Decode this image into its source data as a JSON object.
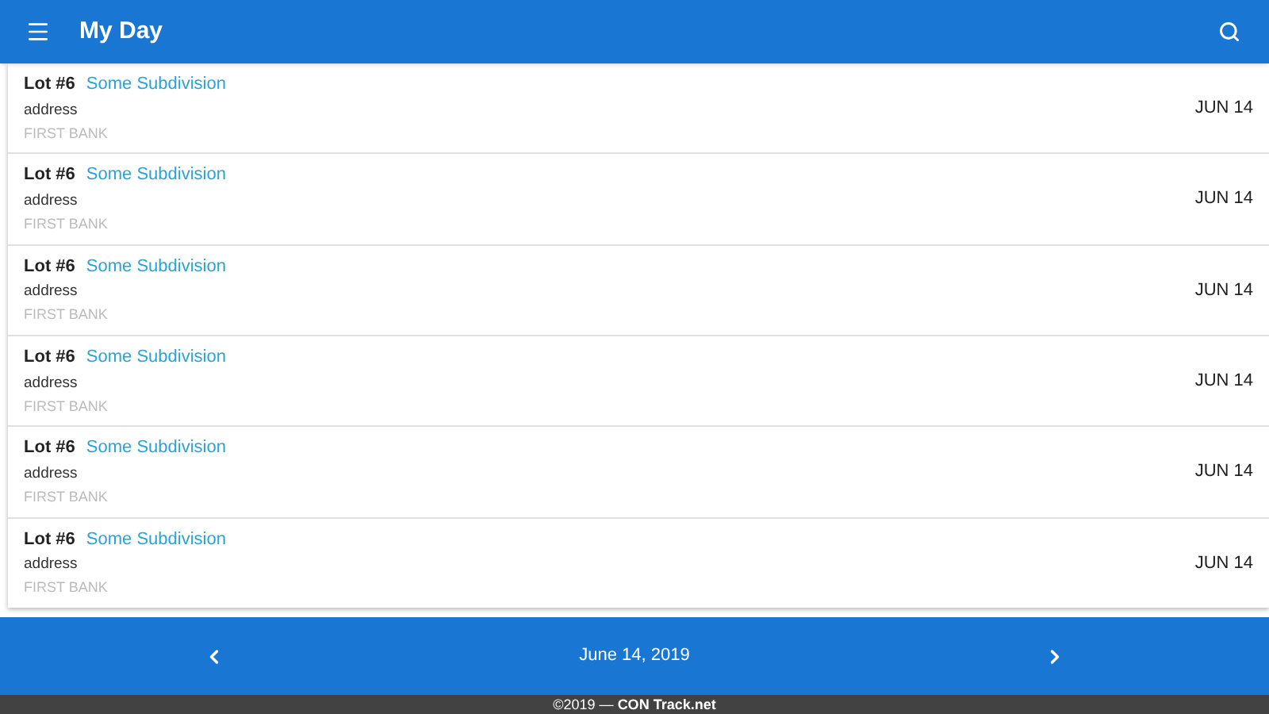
{
  "app_bar": {
    "title": "My Day"
  },
  "items": [
    {
      "lot": "Lot #6",
      "subdivision": "Some Subdivision",
      "address": "address",
      "bank": "FIRST BANK",
      "date": "JUN 14"
    },
    {
      "lot": "Lot #6",
      "subdivision": "Some Subdivision",
      "address": "address",
      "bank": "FIRST BANK",
      "date": "JUN 14"
    },
    {
      "lot": "Lot #6",
      "subdivision": "Some Subdivision",
      "address": "address",
      "bank": "FIRST BANK",
      "date": "JUN 14"
    },
    {
      "lot": "Lot #6",
      "subdivision": "Some Subdivision",
      "address": "address",
      "bank": "FIRST BANK",
      "date": "JUN 14"
    },
    {
      "lot": "Lot #6",
      "subdivision": "Some Subdivision",
      "address": "address",
      "bank": "FIRST BANK",
      "date": "JUN 14"
    },
    {
      "lot": "Lot #6",
      "subdivision": "Some Subdivision",
      "address": "address",
      "bank": "FIRST BANK",
      "date": "JUN 14"
    }
  ],
  "date_nav": {
    "date": "June 14, 2019"
  },
  "footer": {
    "text": "©2019 — **CON Track.net**"
  }
}
